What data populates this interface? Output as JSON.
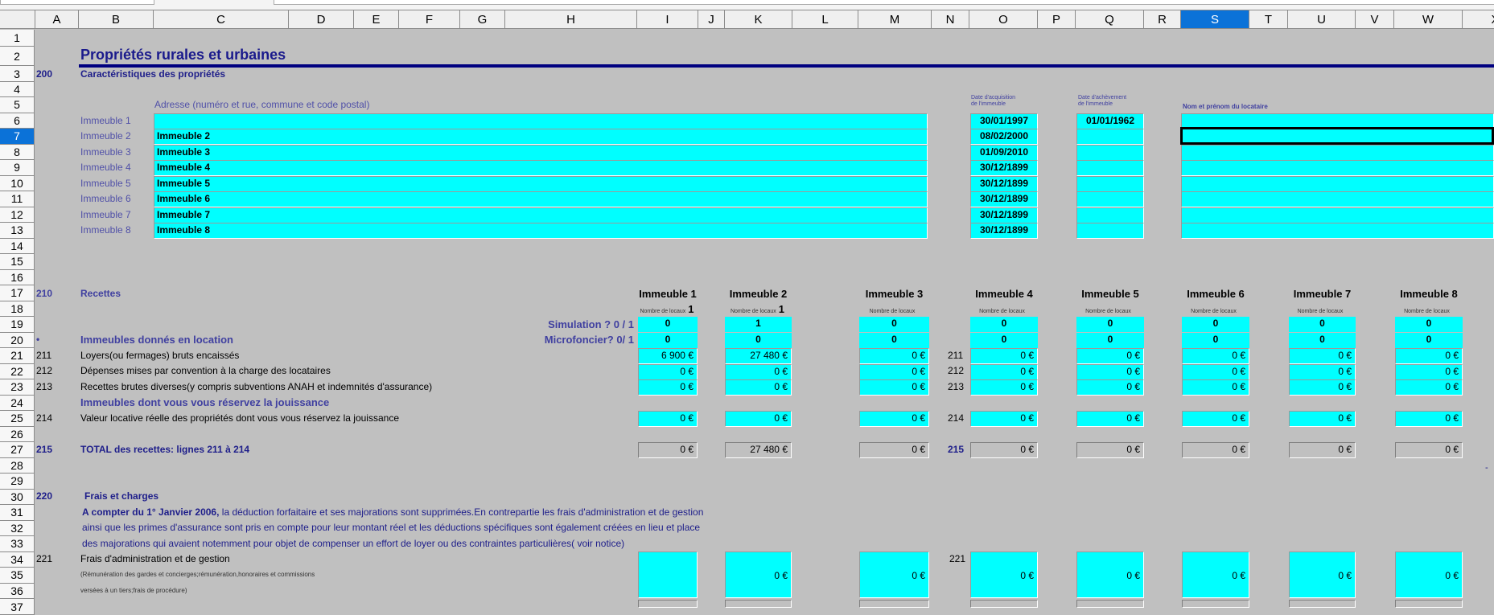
{
  "columns": [
    "A",
    "B",
    "C",
    "D",
    "E",
    "F",
    "G",
    "H",
    "I",
    "J",
    "K",
    "L",
    "M",
    "N",
    "O",
    "P",
    "Q",
    "R",
    "S",
    "T",
    "U",
    "V",
    "W",
    "X"
  ],
  "rows": [
    "1",
    "2",
    "3",
    "4",
    "5",
    "6",
    "7",
    "8",
    "9",
    "10",
    "11",
    "12",
    "13",
    "14",
    "15",
    "16",
    "17",
    "18",
    "19",
    "20",
    "21",
    "22",
    "23",
    "24",
    "25",
    "26",
    "27",
    "28",
    "29",
    "30",
    "31",
    "32",
    "33",
    "34",
    "35",
    "36",
    "37"
  ],
  "selection": {
    "column": "S",
    "row": "7"
  },
  "title": "Propriétés rurales et urbaines",
  "section_200": {
    "code": "200",
    "label": "Caractéristiques des propriétés",
    "address_header": "Adresse (numéro et rue, commune et code postal)",
    "date_acq_header_1": "Date d'acquisition",
    "date_acq_header_2": "de l'immeuble",
    "date_ach_header_1": "Date d'achèvement",
    "date_ach_header_2": "de l'immeuble",
    "tenant_header": "Nom et prénom du locataire",
    "buildings": [
      {
        "label": "Immeuble 1",
        "address": "",
        "date_acq": "30/01/1997",
        "date_ach": "01/01/1962",
        "tenant": ""
      },
      {
        "label": "Immeuble 2",
        "address": "Immeuble 2",
        "date_acq": "08/02/2000",
        "date_ach": "",
        "tenant": ""
      },
      {
        "label": "Immeuble 3",
        "address": "Immeuble 3",
        "date_acq": "01/09/2010",
        "date_ach": "",
        "tenant": ""
      },
      {
        "label": "Immeuble 4",
        "address": "Immeuble 4",
        "date_acq": "30/12/1899",
        "date_ach": "",
        "tenant": ""
      },
      {
        "label": "Immeuble 5",
        "address": "Immeuble 5",
        "date_acq": "30/12/1899",
        "date_ach": "",
        "tenant": ""
      },
      {
        "label": "Immeuble 6",
        "address": "Immeuble 6",
        "date_acq": "30/12/1899",
        "date_ach": "",
        "tenant": ""
      },
      {
        "label": "Immeuble 7",
        "address": "Immeuble 7",
        "date_acq": "30/12/1899",
        "date_ach": "",
        "tenant": ""
      },
      {
        "label": "Immeuble 8",
        "address": "Immeuble 8",
        "date_acq": "30/12/1899",
        "date_ach": "",
        "tenant": ""
      }
    ]
  },
  "section_210": {
    "code": "210",
    "label": "Recettes",
    "nb_locaux_label": "Nombre de locaux",
    "simulation_label": "Simulation ? 0  /  1",
    "microfoncier_label": "Microfoncier? 0/ 1",
    "bullet": "•",
    "location_label": "Immeubles donnés en location",
    "line_211": {
      "code": "211",
      "label": "Loyers(ou fermages) bruts encaissés"
    },
    "line_212": {
      "code": "212",
      "label": "Dépenses mises par convention à la charge des locataires"
    },
    "line_213": {
      "code": "213",
      "label": "Recettes brutes diverses(y compris subventions ANAH et indemnités d'assurance)"
    },
    "jouissance_label": "Immeubles dont vous vous réservez la jouissance",
    "line_214": {
      "code": "214",
      "label": "Valeur locative réelle des propriétés dont vous vous réservez la jouissance"
    },
    "total": {
      "code": "215",
      "label": "TOTAL des recettes: lignes 211 à 214"
    },
    "dash": "-"
  },
  "section_220": {
    "code": "220",
    "label": "Frais et charges",
    "para_bold": "A compter du 1° Janvier 2006,",
    "para_1": " la déduction forfaitaire et ses majorations sont supprimées.En contrepartie les frais d'administration et de gestion",
    "para_2": "ainsi que les primes d'assurance sont pris en compte pour leur montant réel et les déductions spécifiques sont également créées en lieu et place",
    "para_3": "des majorations qui avaient notemment pour objet de compenser un effort de loyer ou des contraintes particulières( voir notice)",
    "line_221": {
      "code": "221",
      "label": "Frais d'administration et de gestion",
      "note_1": "(Rémunération des gardes et concierges;rémunération,honoraires et commissions",
      "note_2": "versées à un tiers;frais de procédure)"
    }
  },
  "immeubles": [
    {
      "name": "Immeuble 1",
      "nb_locaux": "1",
      "simulation": "0",
      "microfoncier": "0",
      "v211": "6 900 €",
      "v212": "0 €",
      "v213": "0 €",
      "v214": "0 €",
      "total": "0 €",
      "v221": ""
    },
    {
      "name": "Immeuble 2",
      "nb_locaux": "1",
      "simulation": "1",
      "microfoncier": "0",
      "v211": "27 480 €",
      "v212": "0 €",
      "v213": "0 €",
      "v214": "0 €",
      "total": "27 480 €",
      "v221": "0 €"
    },
    {
      "name": "Immeuble 3",
      "nb_locaux": "",
      "simulation": "0",
      "microfoncier": "0",
      "v211": "0 €",
      "v212": "0 €",
      "v213": "0 €",
      "v214": "0 €",
      "total": "0 €",
      "v221": "0 €"
    },
    {
      "name": "Immeuble 4",
      "nb_locaux": "",
      "simulation": "0",
      "microfoncier": "0",
      "v211": "0 €",
      "v212": "0 €",
      "v213": "0 €",
      "v214": "0 €",
      "total": "0 €",
      "v221": "0 €"
    },
    {
      "name": "Immeuble 5",
      "nb_locaux": "",
      "simulation": "0",
      "microfoncier": "0",
      "v211": "0 €",
      "v212": "0 €",
      "v213": "0 €",
      "v214": "0 €",
      "total": "0 €",
      "v221": "0 €"
    },
    {
      "name": "Immeuble 6",
      "nb_locaux": "",
      "simulation": "0",
      "microfoncier": "0",
      "v211": "0 €",
      "v212": "0 €",
      "v213": "0 €",
      "v214": "0 €",
      "total": "0 €",
      "v221": "0 €"
    },
    {
      "name": "Immeuble 7",
      "nb_locaux": "",
      "simulation": "0",
      "microfoncier": "0",
      "v211": "0 €",
      "v212": "0 €",
      "v213": "0 €",
      "v214": "0 €",
      "total": "0 €",
      "v221": "0 €"
    },
    {
      "name": "Immeuble 8",
      "nb_locaux": "",
      "simulation": "0",
      "microfoncier": "0",
      "v211": "0 €",
      "v212": "0 €",
      "v213": "0 €",
      "v214": "0 €",
      "total": "0 €",
      "v221": "0 €"
    }
  ]
}
